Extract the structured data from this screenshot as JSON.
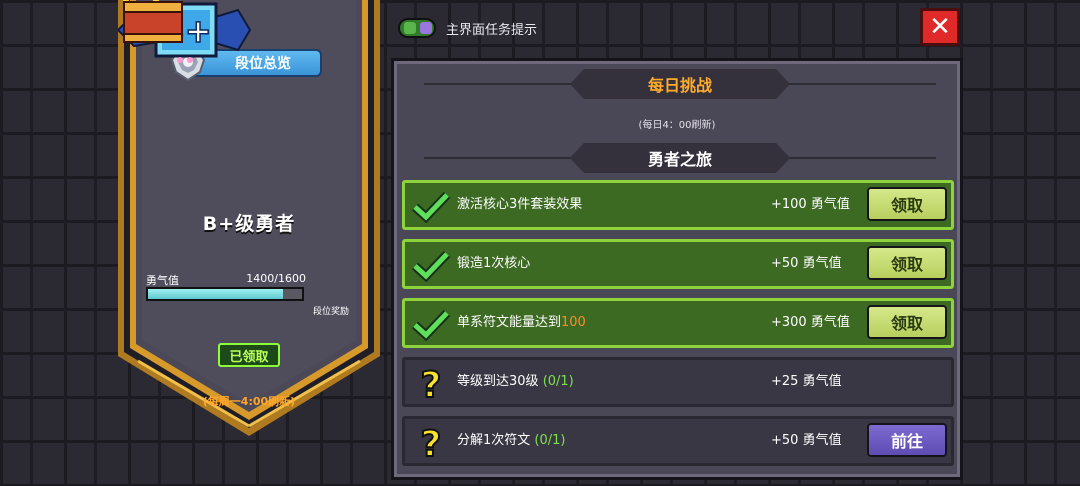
{
  "toggle": {
    "label": "主界面任务提示",
    "on": true
  },
  "close_icon": "close-icon",
  "left": {
    "rank_overview": "段位总览",
    "rank_badge_text": "B+",
    "rank_title": "B+级勇者",
    "courage_label": "勇气值",
    "courage_value": "1400/1600",
    "courage_fraction": 0.875,
    "rank_reward_label": "段位奖励",
    "claimed_label": "已领取",
    "weekly_refresh": "(每周一4:00刷新)"
  },
  "panel": {
    "daily_title": "每日挑战",
    "daily_refresh": "(每日4：00刷新)",
    "journey_title": "勇者之旅",
    "tasks": [
      {
        "status": "done",
        "icon": "check-icon",
        "name": "激活核心3件套装效果",
        "name_highlight": "",
        "progress": "",
        "reward": "+100 勇气值",
        "button": "领取"
      },
      {
        "status": "done",
        "icon": "check-icon",
        "name": "锻造1次核心",
        "name_highlight": "",
        "progress": "",
        "reward": "+50 勇气值",
        "button": "领取"
      },
      {
        "status": "done",
        "icon": "check-icon",
        "name": "单系符文能量达到",
        "name_highlight": "100",
        "progress": "",
        "reward": "+300 勇气值",
        "button": "领取"
      },
      {
        "status": "todo",
        "icon": "question-icon",
        "name": "等级到达30级",
        "name_highlight": "",
        "progress": "(0/1)",
        "reward": "+25 勇气值",
        "button": ""
      },
      {
        "status": "todo",
        "icon": "question-icon",
        "name": "分解1次符文",
        "name_highlight": "",
        "progress": "(0/1)",
        "reward": "+50 勇气值",
        "button": "前往"
      }
    ]
  },
  "colors": {
    "accent_orange": "#ffab2c",
    "done_green": "#8ed23c",
    "claim_button": "#c8dc72",
    "go_button": "#6b58c0",
    "close_red": "#e02a2a"
  }
}
